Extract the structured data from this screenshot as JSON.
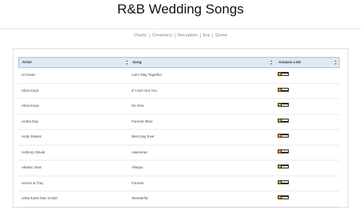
{
  "page": {
    "title": "R&B Wedding Songs"
  },
  "nav": {
    "items": [
      "Charts",
      "Ceremony",
      "Reception",
      "Era",
      "Genre"
    ]
  },
  "table": {
    "headers": {
      "artist": "Artist",
      "song": "Song",
      "amazon": "Amazon Link"
    },
    "rows": [
      {
        "artist": "Al Green",
        "song": "Let's Stay Together",
        "amazon_icon": "amazon-buy-icon"
      },
      {
        "artist": "Alicia Keys",
        "song": "If I Ain't Got You",
        "amazon_icon": "amazon-buy-icon"
      },
      {
        "artist": "Alicia Keys",
        "song": "No One",
        "amazon_icon": "amazon-buy-icon"
      },
      {
        "artist": "Andra Day",
        "song": "Forever Mine",
        "amazon_icon": "amazon-buy-icon"
      },
      {
        "artist": "Andy Stokes",
        "song": "Best Day Ever",
        "amazon_icon": "amazon-buy-icon"
      },
      {
        "artist": "Anthony David",
        "song": "Awesome",
        "amazon_icon": "amazon-buy-icon"
      },
      {
        "artist": "Atlantic Starr",
        "song": "Always",
        "amazon_icon": "amazon-buy-icon"
      },
      {
        "artist": "Arrsen & Trey",
        "song": "Forever",
        "amazon_icon": "amazon-buy-icon"
      },
      {
        "artist": "Arika Kane feat. Kmxlz",
        "song": "Wonderful",
        "amazon_icon": "amazon-buy-icon"
      }
    ]
  },
  "colors": {
    "header_bg": "#dfe9f5",
    "header_border": "#a9c4e4",
    "amazon_accent": "#f0a21b"
  }
}
